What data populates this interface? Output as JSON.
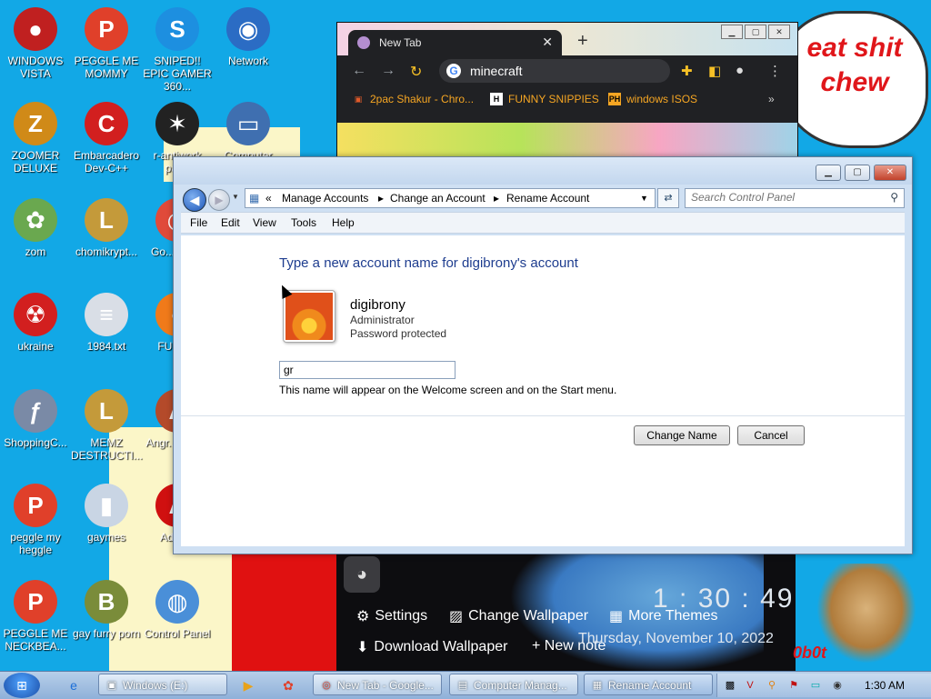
{
  "desktop": {
    "speech_text": "eat shit chew",
    "icons": [
      {
        "label": "WINDOWS VISTA",
        "glyph": "●",
        "color": "#c02020"
      },
      {
        "label": "PEGGLE ME MOMMY",
        "glyph": "P",
        "color": "#e0402a"
      },
      {
        "label": "SNIPED!! EPIC GAMER 360...",
        "glyph": "S",
        "color": "#1d8fe0"
      },
      {
        "label": "Network",
        "glyph": "◉",
        "color": "#2b6cc4"
      },
      {
        "label": "ZOOMER DELUXE",
        "glyph": "Z",
        "color": "#d08a18"
      },
      {
        "label": "Embarcadero Dev-C++",
        "glyph": "C",
        "color": "#d21f1f"
      },
      {
        "label": "r-antiwork par...",
        "glyph": "✶",
        "color": "#222222"
      },
      {
        "label": "Computer",
        "glyph": "▭",
        "color": "#3f6fb0"
      },
      {
        "label": "zom",
        "glyph": "✿",
        "color": "#6aa84f"
      },
      {
        "label": "chomikrypt...",
        "glyph": "L",
        "color": "#c49a3a"
      },
      {
        "label": "Go... Chr...",
        "glyph": "◎",
        "color": "#e04a3a"
      },
      {
        "label": "ukraine",
        "glyph": "☢",
        "color": "#d21f1f"
      },
      {
        "label": "1984.txt",
        "glyph": "≡",
        "color": "#d9dee6"
      },
      {
        "label": "FURR...",
        "glyph": "◐",
        "color": "#f07a1a"
      },
      {
        "label": "ShoppingC...",
        "glyph": "ƒ",
        "color": "#7a8aa6"
      },
      {
        "label": "MEMZ DESTRUCTI...",
        "glyph": "L",
        "color": "#c49a3a"
      },
      {
        "label": "Angr... Sea...",
        "glyph": "A",
        "color": "#b44a2a"
      },
      {
        "label": "peggle my heggle",
        "glyph": "P",
        "color": "#e0402a"
      },
      {
        "label": "gaymes",
        "glyph": "▮",
        "color": "#c9d5e4"
      },
      {
        "label": "Adob...",
        "glyph": "A",
        "color": "#d01010"
      },
      {
        "label": "PEGGLE ME NECKBEA...",
        "glyph": "P",
        "color": "#e0402a"
      },
      {
        "label": "gay furry porn",
        "glyph": "B",
        "color": "#7a8c3a"
      },
      {
        "label": "Control Panel",
        "glyph": "◍",
        "color": "#4a8fd8"
      }
    ]
  },
  "chrome": {
    "tab_title": "New Tab",
    "tab_close": "✕",
    "new_tab": "+",
    "omnibox_value": "minecraft",
    "bookmarks": [
      {
        "icon": "▣",
        "label": "2pac Shakur - Chro..."
      },
      {
        "icon": "H",
        "label": "FUNNY SNIPPIES"
      },
      {
        "icon": "PH",
        "label": "windows ISOS"
      }
    ],
    "bookmarks_more": "»"
  },
  "control_panel": {
    "breadcrumb": {
      "overflow": "«",
      "items": [
        "Manage Accounts",
        "Change an Account",
        "Rename Account"
      ]
    },
    "search_placeholder": "Search Control Panel",
    "menu": [
      "File",
      "Edit",
      "View",
      "Tools",
      "Help"
    ],
    "heading": "Type a new account name for digibrony's account",
    "account": {
      "name": "digibrony",
      "role": "Administrator",
      "status": "Password protected"
    },
    "new_name_value": "gr",
    "hint": "This name will appear on the Welcome screen and on the Start menu.",
    "buttons": {
      "change": "Change Name",
      "cancel": "Cancel"
    }
  },
  "widget": {
    "settings": "Settings",
    "change_wallpaper": "Change Wallpaper",
    "more_themes": "More Themes",
    "download_wallpaper": "Download Wallpaper",
    "new_note": "+ New note",
    "clock": "1 : 30 : 49",
    "date": "Thursday, November 10, 2022",
    "bot_text": "0b0t"
  },
  "taskbar": {
    "buttons": [
      {
        "icon": "▣",
        "label": "Windows (E:)"
      },
      {
        "icon": "◎",
        "label": "New Tab - Google..."
      },
      {
        "icon": "▤",
        "label": "Computer Manag..."
      },
      {
        "icon": "▦",
        "label": "Rename Account"
      }
    ],
    "clock": "1:30 AM"
  }
}
